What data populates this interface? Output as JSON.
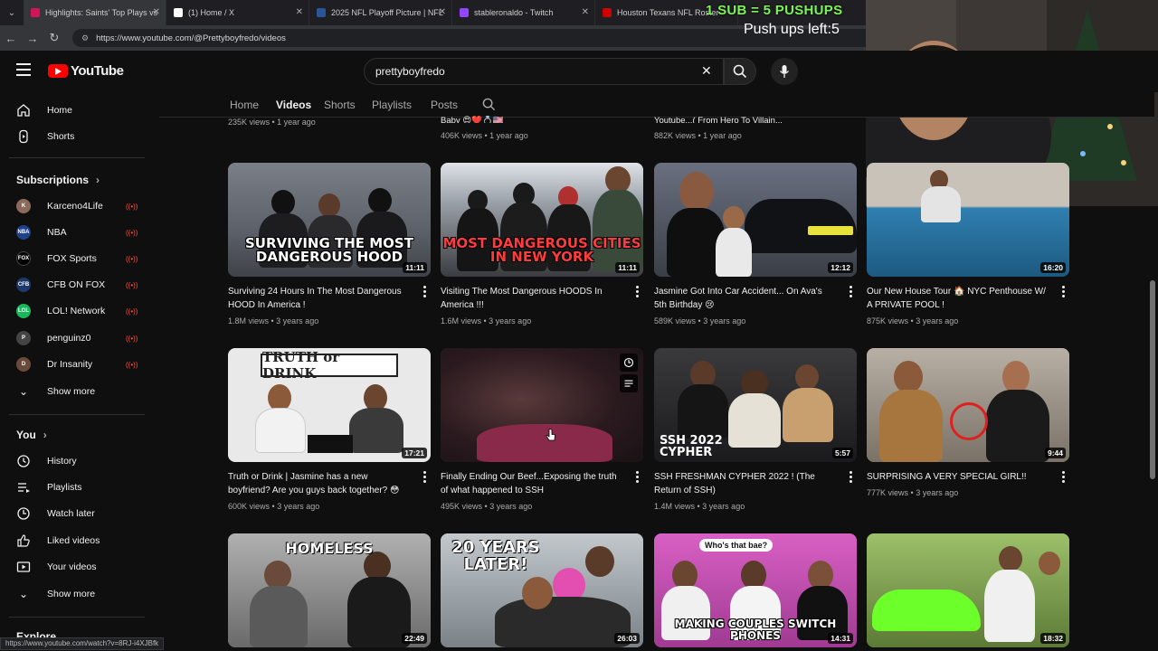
{
  "browser": {
    "tabs": [
      {
        "title": "Highlights: Saints' Top Plays vs",
        "color": "#d4145a"
      },
      {
        "title": "(1) Home / X",
        "color": "#ffffff"
      },
      {
        "title": "2025 NFL Playoff Picture | NFL",
        "color": "#2a5599"
      },
      {
        "title": "stableronaldo - Twitch",
        "color": "#9146ff"
      },
      {
        "title": "Houston Texans NFL Roster",
        "color": "#cc0000"
      }
    ],
    "url": "https://www.youtube.com/@Prettyboyfredo/videos",
    "status_url": "https://www.youtube.com/watch?v=8RJ-i4XJBfk"
  },
  "overlay": {
    "sub_text": "1 SUB = 5 PUSHUPS",
    "pushups_text": "Push ups left:5"
  },
  "header": {
    "logo_text": "YouTube",
    "search_value": "prettyboyfredo"
  },
  "channel_tabs": [
    "Home",
    "Videos",
    "Shorts",
    "Playlists",
    "Posts"
  ],
  "sidebar": {
    "main": [
      {
        "label": "Home",
        "icon": "home-icon"
      },
      {
        "label": "Shorts",
        "icon": "shorts-icon"
      }
    ],
    "subscriptions_heading": "Subscriptions",
    "subscriptions": [
      {
        "label": "Karceno4Life",
        "avatar_color": "#8a6b5b",
        "abbr": "K"
      },
      {
        "label": "NBA",
        "avatar_color": "#1d428a",
        "abbr": "NBA"
      },
      {
        "label": "FOX Sports",
        "avatar_color": "#000000",
        "abbr": "FOX"
      },
      {
        "label": "CFB ON FOX",
        "avatar_color": "#1b3a6b",
        "abbr": "CFB"
      },
      {
        "label": "LOL! Network",
        "avatar_color": "#18b85c",
        "abbr": "LOL"
      },
      {
        "label": "penguinz0",
        "avatar_color": "#444444",
        "abbr": "P"
      },
      {
        "label": "Dr Insanity",
        "avatar_color": "#6a4b3b",
        "abbr": "D"
      }
    ],
    "show_more": "Show more",
    "you_heading": "You",
    "you_items": [
      {
        "label": "History",
        "icon": "history-icon"
      },
      {
        "label": "Playlists",
        "icon": "playlists-icon"
      },
      {
        "label": "Watch later",
        "icon": "watch-later-icon"
      },
      {
        "label": "Liked videos",
        "icon": "liked-icon"
      },
      {
        "label": "Your videos",
        "icon": "your-videos-icon"
      }
    ],
    "show_more_2": "Show more",
    "explore_heading": "Explore"
  },
  "above_row": [
    {
      "meta": "235K views • 1 year ago"
    },
    {
      "title": "Baby 😍❤️💍🇺🇸",
      "meta": "406K views • 1 year ago"
    },
    {
      "title": "Youtube...( From Hero To Villain...",
      "meta": "882K views • 1 year ago"
    }
  ],
  "videos": [
    {
      "title": "Surviving 24 Hours In The Most Dangerous HOOD In America !",
      "views": "1.8M views",
      "age": "3 years ago",
      "duration": "11:11",
      "caption": "SURVIVING THE MOST DANGEROUS HOOD",
      "bg": "#6b6f78"
    },
    {
      "title": "Visiting The Most Dangerous HOODS In America !!!",
      "views": "1.6M views",
      "age": "3 years ago",
      "duration": "11:11",
      "caption": "MOST DANGEROUS CITIES IN NEW YORK",
      "bg": "#5a5d63"
    },
    {
      "title": "Jasmine Got Into Car Accident... On Ava's 5th Birthday 😢",
      "views": "589K views",
      "age": "3 years ago",
      "duration": "12:12",
      "caption": "",
      "bg": "#4a505a"
    },
    {
      "title": "Our New House Tour 🏠 NYC Penthouse W/ A PRIVATE POOL !",
      "views": "875K views",
      "age": "3 years ago",
      "duration": "16:20",
      "caption": "",
      "bg": "#3a6e8c"
    },
    {
      "title": "Truth or Drink | Jasmine has a new boyfriend? Are you guys back together? 😳",
      "views": "600K views",
      "age": "3 years ago",
      "duration": "17:21",
      "caption": "TRUTH or DRINK",
      "bg": "#e9e9e9"
    },
    {
      "title": "Finally Ending Our Beef...Exposing the truth of what happened to SSH",
      "views": "495K views",
      "age": "3 years ago",
      "duration": "",
      "caption": "",
      "bg": "#5b3a45"
    },
    {
      "title": "SSH FRESHMAN CYPHER 2022 ! (The Return of SSH)",
      "views": "1.4M views",
      "age": "3 years ago",
      "duration": "5:57",
      "caption": "SSH 2022 CYPHER",
      "bg": "#2a2a2c"
    },
    {
      "title": "SURPRISING A VERY SPECIAL GIRL!!",
      "views": "777K views",
      "age": "3 years ago",
      "duration": "9:44",
      "caption": "",
      "bg": "#8d8477"
    },
    {
      "title": "",
      "views": "",
      "age": "",
      "duration": "22:49",
      "caption": "HOMELESS",
      "bg": "#8a8a8a"
    },
    {
      "title": "",
      "views": "",
      "age": "",
      "duration": "26:03",
      "caption": "20 YEARS LATER!",
      "bg": "#9aa2a8"
    },
    {
      "title": "",
      "views": "",
      "age": "",
      "duration": "14:31",
      "caption": "MAKING COUPLES SWITCH PHONES",
      "bg": "#c24bb0"
    },
    {
      "title": "",
      "views": "",
      "age": "",
      "duration": "18:32",
      "caption": "",
      "bg": "#7fa64a"
    }
  ],
  "thumb_extra": {
    "who_bae": "Who's that bae?"
  }
}
